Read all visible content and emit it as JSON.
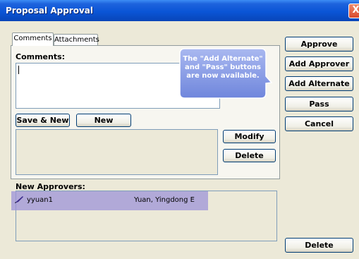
{
  "window": {
    "title": "Proposal Approval",
    "close_glyph": "X"
  },
  "tabs": [
    {
      "label": "Comments",
      "active": true
    },
    {
      "label": "Attachments",
      "active": false
    }
  ],
  "comments": {
    "label": "Comments:",
    "value": ""
  },
  "buttons": {
    "save_new": "Save & New",
    "new": "New",
    "modify": "Modify",
    "delete": "Delete",
    "approve": "Approve",
    "add_approver": "Add Approver",
    "add_alternate": "Add Alternate",
    "pass": "Pass",
    "cancel": "Cancel",
    "delete_approver": "Delete"
  },
  "new_approvers": {
    "label": "New Approvers:",
    "rows": [
      {
        "id": "yyuan1",
        "name": "Yuan, Yingdong E",
        "icon": "pen-icon"
      }
    ]
  },
  "callout": {
    "text": "The \"Add Alternate\" and \"Pass\" buttons are now available."
  },
  "colors": {
    "title_bar": "#0a55d6",
    "highlight": "#9d93d8",
    "callout": "#7d92e0"
  }
}
